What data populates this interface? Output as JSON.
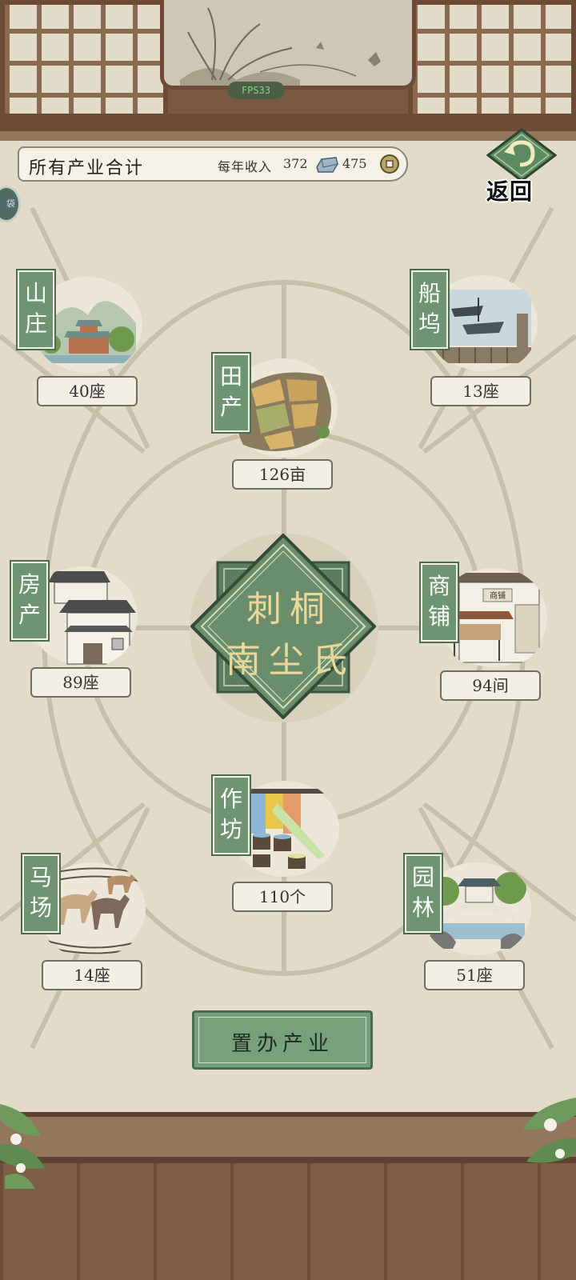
{
  "fps": "FPS33",
  "totals": {
    "title": "所有产业合计",
    "income_label": "每年收入",
    "silver": "372",
    "coins": "475"
  },
  "side_tab": "袋",
  "back_label": "返回",
  "estates": {
    "villa": {
      "name": "山庄",
      "count": "40座"
    },
    "dock": {
      "name": "船坞",
      "count": "13座"
    },
    "farmland": {
      "name": "田产",
      "count": "126亩"
    },
    "house": {
      "name": "房产",
      "count": "89座"
    },
    "shop": {
      "name": "商铺",
      "count": "94间"
    },
    "workshop": {
      "name": "作坊",
      "count": "110个"
    },
    "stable": {
      "name": "马场",
      "count": "14座"
    },
    "garden": {
      "name": "园林",
      "count": "51座"
    }
  },
  "emblem": {
    "line1": "刺桐",
    "line2": "南尘氏"
  },
  "shop_sign": "商铺",
  "buy_button": "置办产业",
  "colors": {
    "panel": "#e2dbc8",
    "wood": "#7a5a42",
    "green_label": "#6e9471",
    "emblem_green": "#5d7d60",
    "emblem_text": "#ead89a"
  }
}
